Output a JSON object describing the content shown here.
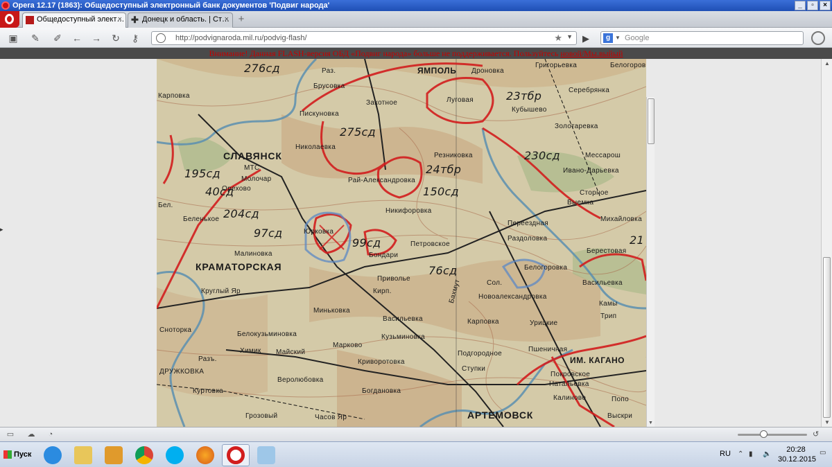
{
  "window": {
    "title": "Opera 12.17 (1863): Общедоступный электронный банк документов 'Подвиг народа'",
    "buttons": [
      "_",
      "▫",
      "×"
    ]
  },
  "tabs": [
    {
      "label": "Общедоступный элект…",
      "close": "×",
      "active": true
    },
    {
      "label": "Донецк и область. | Ст…",
      "close": "×",
      "active": false
    }
  ],
  "new_tab": "+",
  "nav": {
    "url": "http://podvignaroda.mil.ru/podvig-flash/",
    "star": "★",
    "search_placeholder": "Google",
    "go": "▶"
  },
  "banner": {
    "text": "Внимание! Данная FLASH-версия ОБД «Подвиг народа» больше не поддерживается. Пользуйтесь",
    "link": "новой/Mы.выйый"
  },
  "map": {
    "towns": [
      "Раз.",
      "Брусовка",
      "ЯМПОЛЬ",
      "Дроновка",
      "Григорьевка",
      "Белогоровка",
      "Карповка",
      "Пискуновка",
      "Закотное",
      "Луговая",
      "Серебрянка",
      "Кубышево",
      "Николаевка",
      "Золотаревка",
      "СЛАВЯНСК",
      "МТС",
      "Рай-Александровка",
      "Резниковка",
      "Мессарош",
      "Ивано-Дарьевка",
      "Сторное",
      "Выемка",
      "Михайловка",
      "Молочар",
      "Орехово",
      "Бел.",
      "Беленькое",
      "Юрковка",
      "Никифоровка",
      "Переездная",
      "Раздоловка",
      "Петровское",
      "Бондари",
      "Берестовая",
      "Малиновка",
      "КРАМАТОРСКАЯ",
      "Приволье",
      "Белогоровка",
      "Васильевка",
      "Круглый Яр",
      "Кирп.",
      "Новоалександровка",
      "Камы",
      "Миньковка",
      "Сол.",
      "Карповка",
      "Урицкие",
      "Трип",
      "Белокузьминовка",
      "Васильевка",
      "Кузьминовка",
      "Марково",
      "Подгородное",
      "Пшеничная",
      "ИМ. КАГАНО",
      "Химик",
      "Майский",
      "Криворотовка",
      "Ступки",
      "Покровское",
      "Натальевка",
      "ДРУЖКОВКА",
      "Веролюбовка",
      "Куртовка",
      "Богдановка",
      "Калиново",
      "Попо",
      "Грозовый",
      "Часов Яр",
      "АРТЕМОВСК",
      "Выскри",
      "Сноторка",
      "Разъ.",
      "Бахмут"
    ],
    "units": [
      "276сд",
      "275сд",
      "23тбр",
      "230сд",
      "24тбр",
      "150сд",
      "204сд",
      "97сд",
      "99сд",
      "76сд",
      "195сд",
      "40сд",
      "21"
    ]
  },
  "statusbar": {
    "icons": [
      "panel-icon",
      "cloud-icon",
      "speed-icon"
    ]
  },
  "taskbar": {
    "start": "Пуск",
    "lang": "RU",
    "time": "20:28",
    "date": "30.12.2015"
  }
}
